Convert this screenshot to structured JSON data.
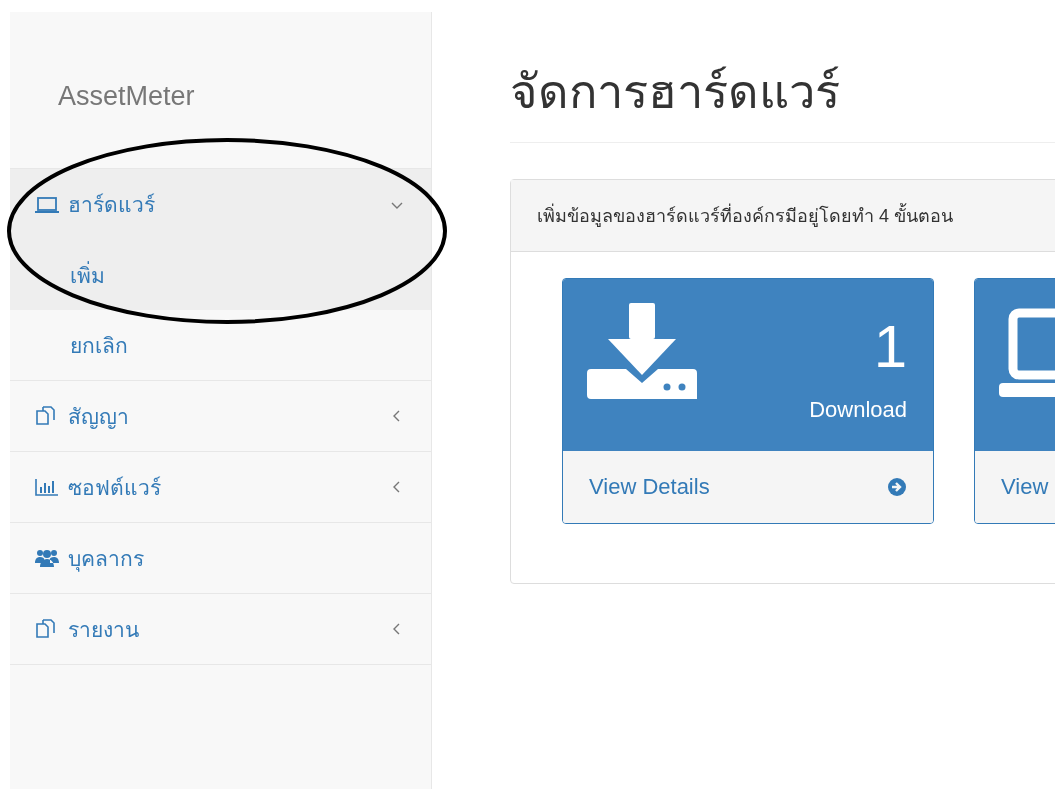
{
  "brand": "AssetMeter",
  "title": "จัดการฮาร์ดแวร์",
  "nav": [
    {
      "label": "ฮาร์ดแวร์",
      "kind": "laptop",
      "expanded": true,
      "children": [
        {
          "label": "เพิ่ม",
          "selected": true
        },
        {
          "label": "ยกเลิก",
          "selected": false
        }
      ]
    },
    {
      "label": "สัญญา",
      "kind": "copy",
      "expanded": false
    },
    {
      "label": "ซอฟต์แวร์",
      "kind": "chart",
      "expanded": false
    },
    {
      "label": "บุคลากร",
      "kind": "users"
    },
    {
      "label": "รายงาน",
      "kind": "copy",
      "expanded": false
    }
  ],
  "panel": {
    "heading": "เพิ่มข้อมูลของฮาร์ดแวร์ที่องค์กรมีอยู่โดยทำ 4 ขั้นตอน",
    "cards": [
      {
        "kind": "download",
        "number": "1",
        "caption": "Download",
        "link": "View Details"
      },
      {
        "kind": "laptop",
        "link": "View"
      }
    ]
  },
  "annotations": [
    {
      "kind": "ellipse"
    }
  ]
}
